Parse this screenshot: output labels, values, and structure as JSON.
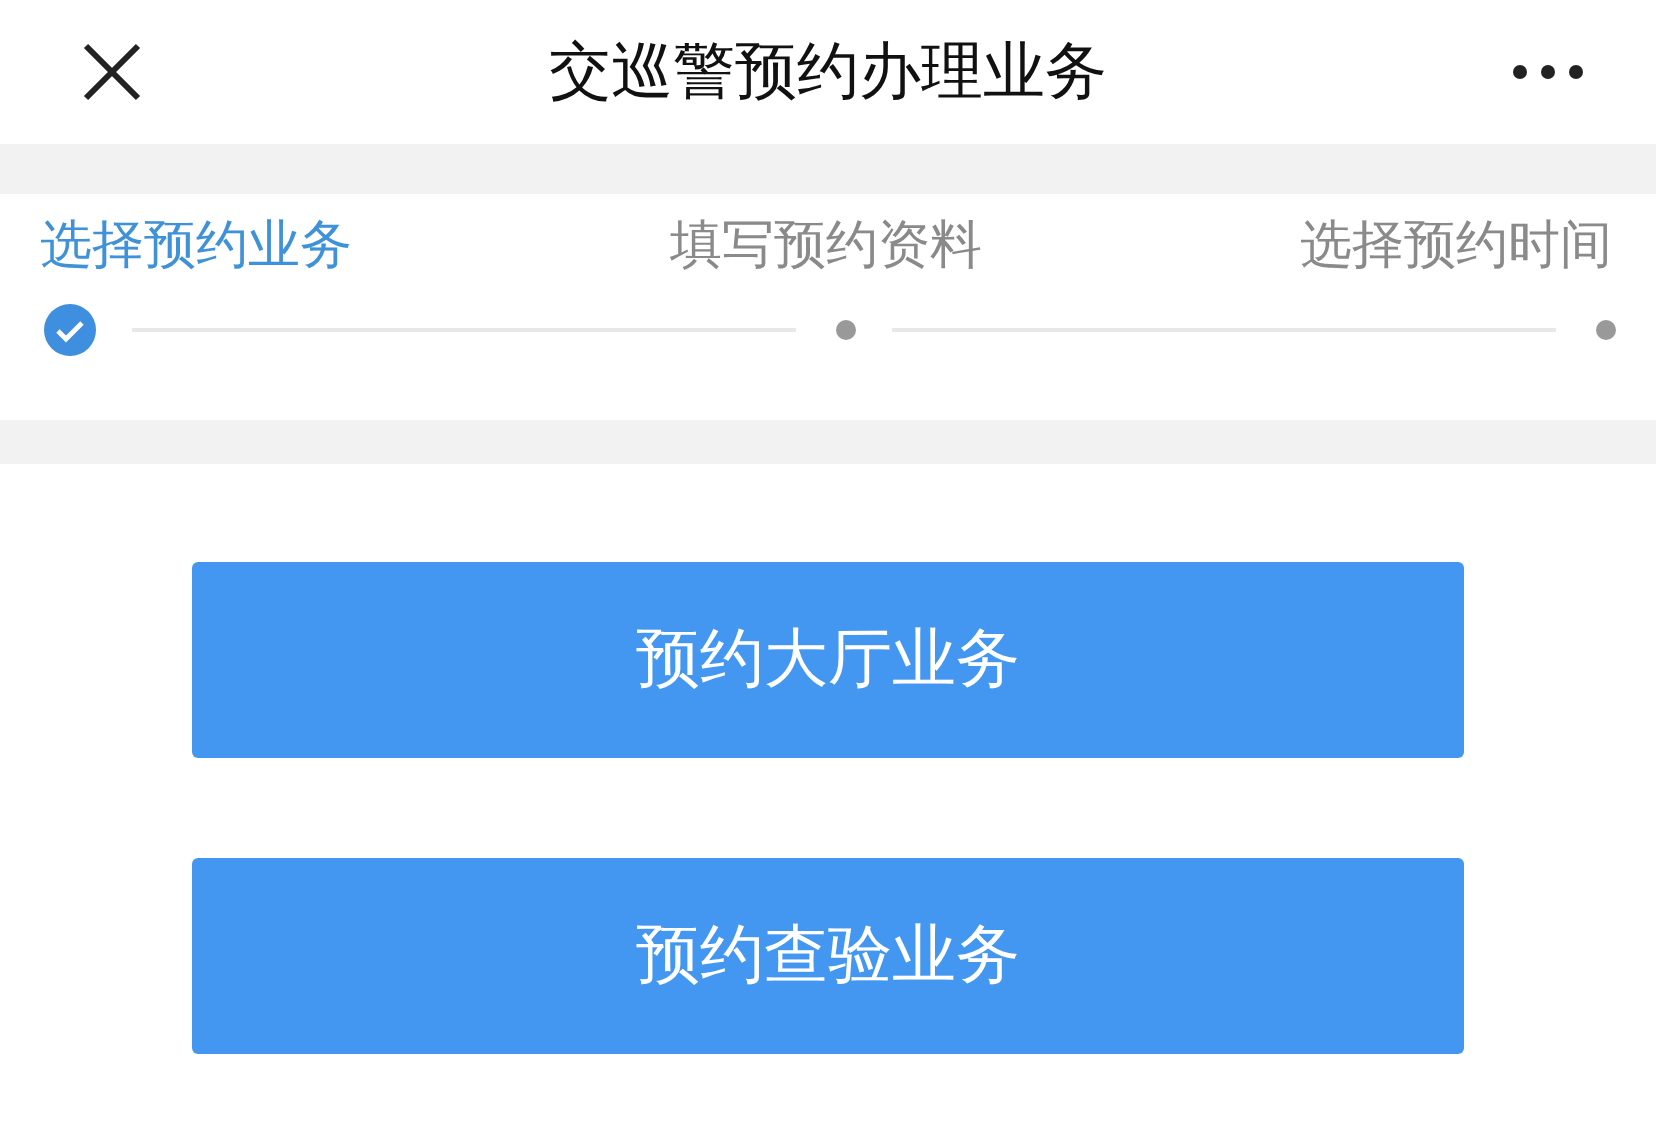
{
  "header": {
    "title": "交巡警预约办理业务"
  },
  "steps": [
    {
      "label": "选择预约业务",
      "completed": true
    },
    {
      "label": "填写预约资料",
      "completed": false
    },
    {
      "label": "选择预约时间",
      "completed": false
    }
  ],
  "buttons": [
    {
      "label": "预约大厅业务"
    },
    {
      "label": "预约查验业务"
    }
  ]
}
